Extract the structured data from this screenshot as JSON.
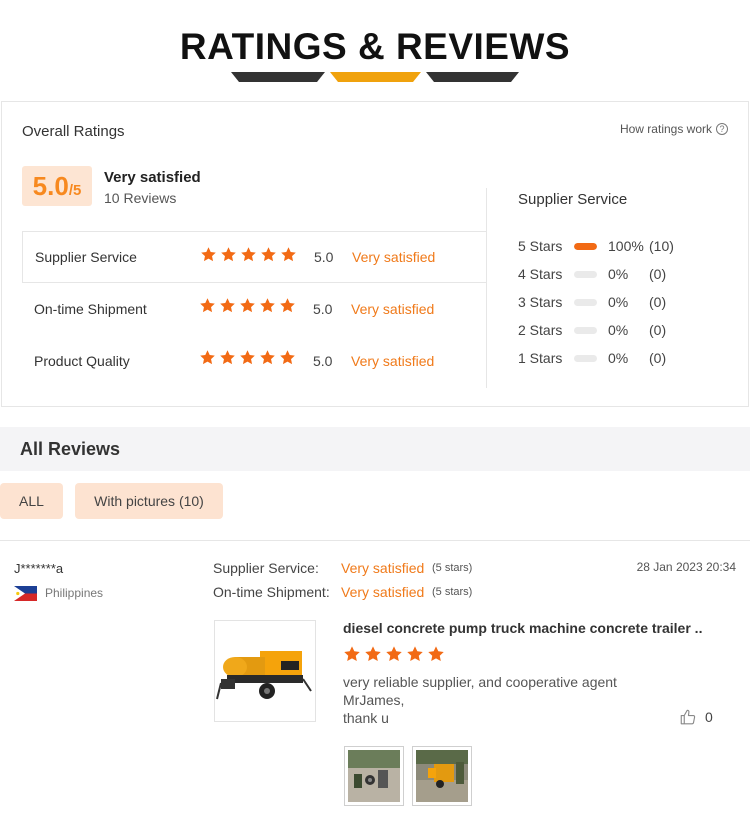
{
  "header": {
    "title": "RATINGS & REVIEWS"
  },
  "overall": {
    "label": "Overall Ratings",
    "how_link": "How ratings work",
    "score": "5.0",
    "score_suffix": "/5",
    "score_label": "Very satisfied",
    "review_count": "10 Reviews"
  },
  "categories": [
    {
      "name": "Supplier Service",
      "stars": 5,
      "value": "5.0",
      "text": "Very satisfied"
    },
    {
      "name": "On-time Shipment",
      "stars": 5,
      "value": "5.0",
      "text": "Very satisfied"
    },
    {
      "name": "Product Quality",
      "stars": 5,
      "value": "5.0",
      "text": "Very satisfied"
    }
  ],
  "distribution": {
    "title": "Supplier Service",
    "rows": [
      {
        "label": "5 Stars",
        "fraction": 1.0,
        "pct": "100%",
        "count": "(10)"
      },
      {
        "label": "4 Stars",
        "fraction": 0,
        "pct": "0%",
        "count": "(0)"
      },
      {
        "label": "3 Stars",
        "fraction": 0,
        "pct": "0%",
        "count": "(0)"
      },
      {
        "label": "2 Stars",
        "fraction": 0,
        "pct": "0%",
        "count": "(0)"
      },
      {
        "label": "1 Stars",
        "fraction": 0,
        "pct": "0%",
        "count": "(0)"
      }
    ]
  },
  "reviews_section": {
    "title": "All Reviews",
    "filters": [
      "ALL",
      "With pictures (10)"
    ]
  },
  "review": {
    "reviewer": "J*******a",
    "country": "Philippines",
    "date": "28 Jan 2023 20:34",
    "meta": [
      {
        "label": "Supplier Service:",
        "value": "Very satisfied",
        "stars": "(5 stars)"
      },
      {
        "label": "On-time Shipment:",
        "value": "Very satisfied",
        "stars": "(5 stars)"
      }
    ],
    "product_title": "diesel concrete pump truck machine concrete trailer ...",
    "rating": 5,
    "lines": [
      "very reliable supplier, and cooperative agent",
      "MrJames,",
      "thank u"
    ],
    "likes": "0"
  },
  "colors": {
    "accent": "#f26a14",
    "badge_bg": "#fde5d3",
    "star": "#f26a14"
  }
}
